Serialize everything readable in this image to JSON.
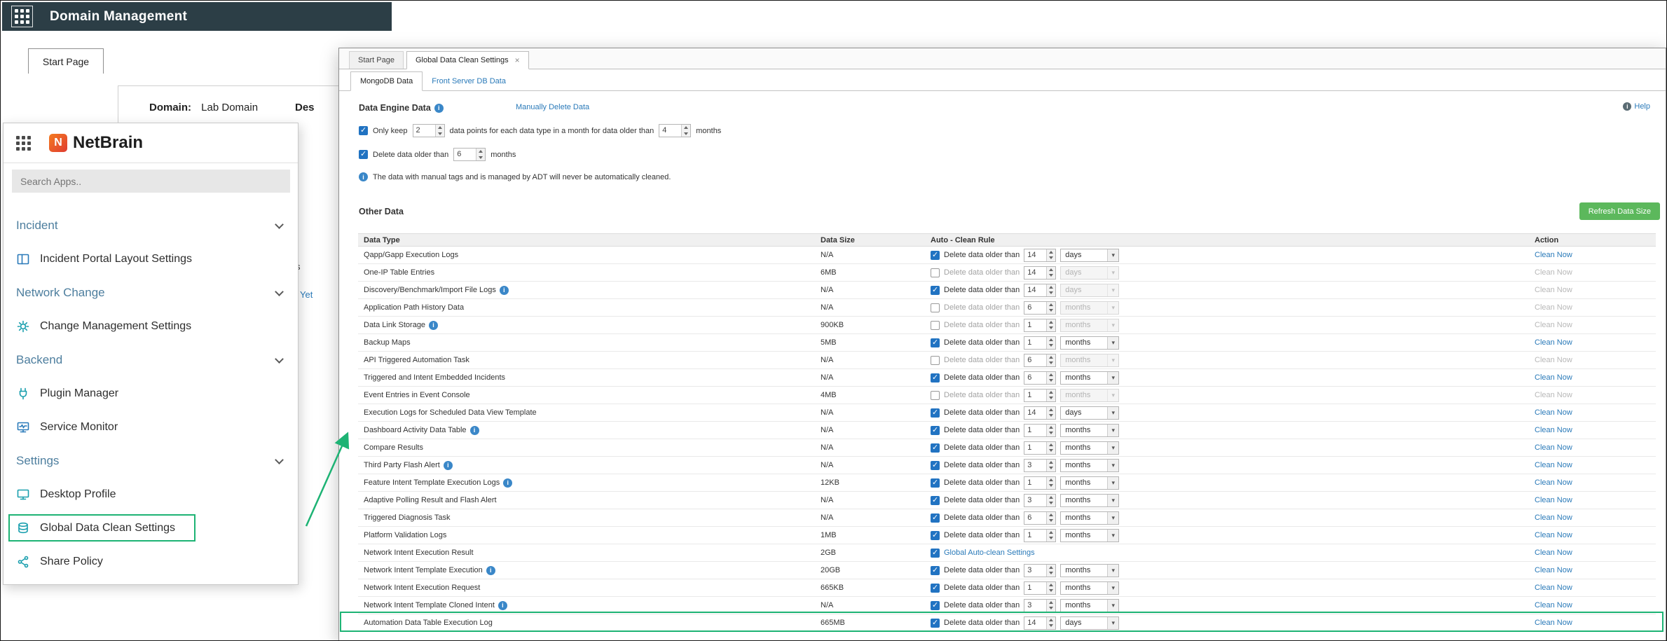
{
  "colors": {
    "header_bg": "#2c3e46",
    "link_blue": "#2a7ab9",
    "checkbox_blue": "#2173c2",
    "annotation_green": "#1db374",
    "button_green": "#5cb85c",
    "section_header_blue": "#4d7e9e"
  },
  "header": {
    "title": "Domain Management"
  },
  "main_page": {
    "tab_label": "Start Page",
    "domain_label": "Domain:",
    "domain_value": "Lab Domain",
    "desc_fragment": "Des",
    "fragment_s": "s",
    "fragment_yet": "Yet"
  },
  "app_menu": {
    "logo_text": "NetBrain",
    "logo_mark": "N",
    "search_placeholder": "Search Apps..",
    "sections": [
      {
        "label": "Incident",
        "items": [
          "Incident Portal Layout Settings"
        ]
      },
      {
        "label": "Network Change",
        "items": [
          "Change Management Settings"
        ]
      },
      {
        "label": "Backend",
        "items": [
          "Plugin Manager",
          "Service Monitor"
        ]
      },
      {
        "label": "Settings",
        "items": [
          "Desktop Profile",
          "Global Data Clean Settings",
          "Share Policy"
        ]
      }
    ]
  },
  "dialog": {
    "tabs": [
      {
        "label": "Start Page"
      },
      {
        "label": "Global Data Clean Settings",
        "active": true,
        "closable": true
      }
    ],
    "subtabs": [
      {
        "label": "MongoDB Data",
        "active": true
      },
      {
        "label": "Front Server DB Data"
      }
    ],
    "data_engine": {
      "title": "Data Engine Data",
      "manual_delete_link": "Manually Delete Data",
      "help_label": "Help",
      "rule1": {
        "checked": true,
        "prefix": "Only keep",
        "value1": "2",
        "middle": "data points for each data type in a month for data older than",
        "value2": "4",
        "suffix": "months"
      },
      "rule2": {
        "checked": true,
        "label": "Delete data older than",
        "value": "6",
        "suffix": "months"
      },
      "note": "The data with manual tags and is managed by ADT will never be automatically cleaned."
    },
    "other_data": {
      "title": "Other Data",
      "refresh_button": "Refresh Data Size",
      "columns": [
        "Data Type",
        "Data Size",
        "Auto - Clean Rule",
        "Action"
      ],
      "rule_label": "Delete data older than",
      "clean_now_label": "Clean Now",
      "global_link_label": "Global Auto-clean Settings",
      "rows": [
        {
          "name": "Qapp/Gapp Execution Logs",
          "info": false,
          "size": "N/A",
          "checked": true,
          "value": "14",
          "unit": "days",
          "unit_enabled": true,
          "clean_enabled": true
        },
        {
          "name": "One-IP Table Entries",
          "info": false,
          "size": "6MB",
          "checked": false,
          "value": "14",
          "unit": "days",
          "unit_enabled": false,
          "clean_enabled": false
        },
        {
          "name": "Discovery/Benchmark/Import File Logs",
          "info": true,
          "size": "N/A",
          "checked": true,
          "value": "14",
          "unit": "days",
          "unit_enabled": false,
          "clean_enabled": false
        },
        {
          "name": "Application Path History Data",
          "info": false,
          "size": "N/A",
          "checked": false,
          "value": "6",
          "unit": "months",
          "unit_enabled": false,
          "clean_enabled": false
        },
        {
          "name": "Data Link Storage",
          "info": true,
          "size": "900KB",
          "checked": false,
          "value": "1",
          "unit": "months",
          "unit_enabled": false,
          "clean_enabled": false
        },
        {
          "name": "Backup Maps",
          "info": false,
          "size": "5MB",
          "checked": true,
          "value": "1",
          "unit": "months",
          "unit_enabled": true,
          "clean_enabled": true
        },
        {
          "name": "API Triggered Automation Task",
          "info": false,
          "size": "N/A",
          "checked": false,
          "value": "6",
          "unit": "months",
          "unit_enabled": false,
          "clean_enabled": false
        },
        {
          "name": "Triggered and Intent Embedded Incidents",
          "info": false,
          "size": "N/A",
          "checked": true,
          "value": "6",
          "unit": "months",
          "unit_enabled": true,
          "clean_enabled": true
        },
        {
          "name": "Event Entries in Event Console",
          "info": false,
          "size": "4MB",
          "checked": false,
          "value": "1",
          "unit": "months",
          "unit_enabled": false,
          "clean_enabled": false
        },
        {
          "name": "Execution Logs for Scheduled Data View Template",
          "info": false,
          "size": "N/A",
          "checked": true,
          "value": "14",
          "unit": "days",
          "unit_enabled": true,
          "clean_enabled": true
        },
        {
          "name": "Dashboard Activity Data Table",
          "info": true,
          "size": "N/A",
          "checked": true,
          "value": "1",
          "unit": "months",
          "unit_enabled": true,
          "clean_enabled": true
        },
        {
          "name": "Compare Results",
          "info": false,
          "size": "N/A",
          "checked": true,
          "value": "1",
          "unit": "months",
          "unit_enabled": true,
          "clean_enabled": true
        },
        {
          "name": "Third Party Flash Alert",
          "info": true,
          "size": "N/A",
          "checked": true,
          "value": "3",
          "unit": "months",
          "unit_enabled": true,
          "clean_enabled": true
        },
        {
          "name": "Feature Intent Template Execution Logs",
          "info": true,
          "size": "12KB",
          "checked": true,
          "value": "1",
          "unit": "months",
          "unit_enabled": true,
          "clean_enabled": true
        },
        {
          "name": "Adaptive Polling Result and Flash Alert",
          "info": false,
          "size": "N/A",
          "checked": true,
          "value": "3",
          "unit": "months",
          "unit_enabled": true,
          "clean_enabled": true
        },
        {
          "name": "Triggered Diagnosis Task",
          "info": false,
          "size": "N/A",
          "checked": true,
          "value": "6",
          "unit": "months",
          "unit_enabled": true,
          "clean_enabled": true
        },
        {
          "name": "Platform Validation Logs",
          "info": false,
          "size": "1MB",
          "checked": true,
          "value": "1",
          "unit": "months",
          "unit_enabled": true,
          "clean_enabled": true
        },
        {
          "name": "Network Intent Execution Result",
          "info": false,
          "size": "2GB",
          "checked": true,
          "global_link": true,
          "clean_enabled": true
        },
        {
          "name": "Network Intent Template Execution",
          "info": true,
          "size": "20GB",
          "checked": true,
          "value": "3",
          "unit": "months",
          "unit_enabled": true,
          "clean_enabled": true
        },
        {
          "name": "Network Intent Execution Request",
          "info": false,
          "size": "665KB",
          "checked": true,
          "value": "1",
          "unit": "months",
          "unit_enabled": true,
          "clean_enabled": true
        },
        {
          "name": "Network Intent Template Cloned Intent",
          "info": true,
          "size": "N/A",
          "checked": true,
          "value": "3",
          "unit": "months",
          "unit_enabled": true,
          "clean_enabled": true
        },
        {
          "name": "Automation Data Table Execution Log",
          "info": false,
          "size": "665MB",
          "checked": true,
          "value": "14",
          "unit": "days",
          "unit_enabled": true,
          "clean_enabled": true,
          "highlighted": true
        }
      ]
    }
  }
}
